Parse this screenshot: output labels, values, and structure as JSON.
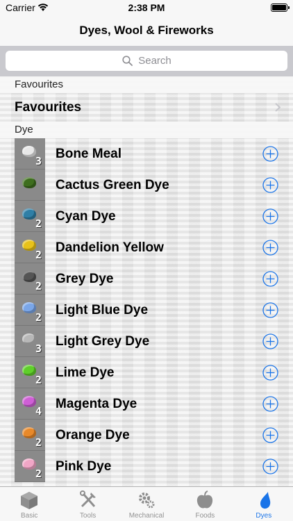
{
  "status_bar": {
    "carrier": "Carrier",
    "time": "2:38 PM"
  },
  "nav": {
    "title": "Dyes, Wool & Fireworks"
  },
  "search": {
    "placeholder": "Search"
  },
  "sections": {
    "favourites_header": "Favourites",
    "favourites_row": "Favourites",
    "dye_header": "Dye"
  },
  "dyes": [
    {
      "name": "Bone Meal",
      "count": "3",
      "color": "#e8e8e8"
    },
    {
      "name": "Cactus Green Dye",
      "count": "",
      "color": "#3e6e1e"
    },
    {
      "name": "Cyan Dye",
      "count": "2",
      "color": "#2f7fa6"
    },
    {
      "name": "Dandelion Yellow",
      "count": "2",
      "color": "#e8c21a"
    },
    {
      "name": "Grey Dye",
      "count": "2",
      "color": "#555555"
    },
    {
      "name": "Light Blue Dye",
      "count": "2",
      "color": "#7aa6e8"
    },
    {
      "name": "Light Grey Dye",
      "count": "3",
      "color": "#b8b8b8"
    },
    {
      "name": "Lime Dye",
      "count": "2",
      "color": "#5fcf2a"
    },
    {
      "name": "Magenta Dye",
      "count": "4",
      "color": "#cf5fd6"
    },
    {
      "name": "Orange Dye",
      "count": "2",
      "color": "#e8892a"
    },
    {
      "name": "Pink Dye",
      "count": "2",
      "color": "#f0a6c6"
    }
  ],
  "tabs": [
    {
      "label": "Basic",
      "icon": "cube-icon"
    },
    {
      "label": "Tools",
      "icon": "tools-icon"
    },
    {
      "label": "Mechanical",
      "icon": "gears-icon"
    },
    {
      "label": "Foods",
      "icon": "apple-icon"
    },
    {
      "label": "Dyes",
      "icon": "drop-icon"
    }
  ],
  "colors": {
    "accent": "#1a74e8",
    "tab_inactive": "#929292"
  }
}
